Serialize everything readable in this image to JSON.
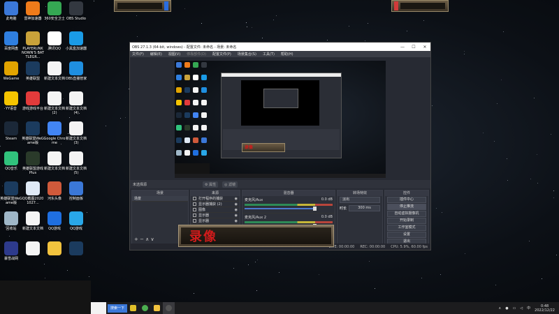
{
  "desktop": {
    "icons": [
      {
        "label": "此电脑",
        "icon": "computer-icon",
        "color": "#3b78d8"
      },
      {
        "label": "雷神加速器",
        "icon": "thunder-accelerator-icon",
        "color": "#ef7b1a"
      },
      {
        "label": "360安全卫士",
        "icon": "360-security-icon",
        "color": "#35a853"
      },
      {
        "label": "OBS Studio",
        "icon": "obs-icon",
        "color": "#333840"
      },
      {
        "label": "百度网盘",
        "icon": "baidu-netdisk-icon",
        "color": "#2f7fe0"
      },
      {
        "label": "PLAYERUNKNOWN'S BATTLEGR...",
        "icon": "pubg-icon",
        "color": "#c9a23a"
      },
      {
        "label": "腾讯QQ",
        "icon": "qq-icon",
        "color": "#ffffff"
      },
      {
        "label": "小黑盒加速器",
        "icon": "xiaoheihe-icon",
        "color": "#1a9be6"
      },
      {
        "label": "WeGame",
        "icon": "wegame-icon",
        "color": "#e2a400"
      },
      {
        "label": "英雄联盟",
        "icon": "lol-icon",
        "color": "#1b3b5e"
      },
      {
        "label": "新建文本文档",
        "icon": "text-file-icon",
        "color": "#f4f4f4"
      },
      {
        "label": "OBS直播管家",
        "icon": "obs-helper-icon",
        "color": "#1f8fe0"
      },
      {
        "label": "YY语音",
        "icon": "yy-icon",
        "color": "#f5c400"
      },
      {
        "label": "游戏游戏平台",
        "icon": "game-platform-icon",
        "color": "#e23b3b"
      },
      {
        "label": "新建文本文档 (2)",
        "icon": "text-file-icon",
        "color": "#f4f4f4"
      },
      {
        "label": "新建文本文档 (4)",
        "icon": "text-file-icon",
        "color": "#f4f4f4"
      },
      {
        "label": "Steam",
        "icon": "steam-icon",
        "color": "#1b2838"
      },
      {
        "label": "英雄联盟WeGame版",
        "icon": "lol-icon",
        "color": "#1b3b5e"
      },
      {
        "label": "Google Chrome",
        "icon": "chrome-icon",
        "color": "#4285f4"
      },
      {
        "label": "新建文本文档 (3)",
        "icon": "text-file-icon",
        "color": "#f4f4f4"
      },
      {
        "label": "QQ音乐",
        "icon": "qq-music-icon",
        "color": "#31c27c"
      },
      {
        "label": "英雄联盟游戏 Plus",
        "icon": "lol-plus-icon",
        "color": "#2a3a2a"
      },
      {
        "label": "新建文本文档",
        "icon": "text-file-icon",
        "color": "#f4f4f4"
      },
      {
        "label": "新建文本文档 (5)",
        "icon": "text-file-icon",
        "color": "#f4f4f4"
      },
      {
        "label": "英雄联盟WeGame版",
        "icon": "lol-icon",
        "color": "#1b3b5e"
      },
      {
        "label": "QQ截图20201027...",
        "icon": "screenshot-icon",
        "color": "#dfe9f5"
      },
      {
        "label": "河东头像",
        "icon": "avatar-image-icon",
        "color": "#d05a3b"
      },
      {
        "label": "控制面板",
        "icon": "control-panel-icon",
        "color": "#3b78d8"
      },
      {
        "label": "回收站",
        "icon": "recycle-bin-icon",
        "color": "#9fb7c8"
      },
      {
        "label": "新建文本文档",
        "icon": "text-file-icon",
        "color": "#f4f4f4"
      },
      {
        "label": "QQ游戏",
        "icon": "qq-game-icon",
        "color": "#1f6fe0"
      },
      {
        "label": "QQ游戏",
        "icon": "qq-game-icon",
        "color": "#29a7e8"
      },
      {
        "label": "暴雪战网",
        "icon": "battlenet-icon",
        "color": "#2d3a8c"
      },
      {
        "label": "",
        "icon": "text-file-icon",
        "color": "#f4f4f4"
      },
      {
        "label": "",
        "icon": "folder-icon",
        "color": "#f2c33e"
      },
      {
        "label": "",
        "icon": "lol-icon",
        "color": "#1b3b5e"
      }
    ]
  },
  "obs": {
    "title": "OBS 27.1.3 (64-bit, windows) - 配置文件: 未命名 - 场景: 未命名",
    "menu": [
      "文件(F)",
      "编辑(E)",
      "视图(V)",
      "停靠部件(D)",
      "配置文件(P)",
      "场景集合(S)",
      "工具(T)",
      "帮助(H)"
    ],
    "status_label": "未选择源",
    "properties_btn": "属性",
    "filters_btn": "滤镜",
    "docks": {
      "scenes": {
        "title": "场景",
        "items": [
          "场景"
        ]
      },
      "sources": {
        "title": "来源",
        "items": [
          "打开程序的捕获",
          "显示器捕获 (2)",
          "图像",
          "显示器",
          "显示器"
        ]
      },
      "mixer": {
        "title": "混音器",
        "channels": [
          {
            "name": "麦克风/Aux",
            "db": "0.0 dB"
          },
          {
            "name": "麦克风/Aux 2",
            "db": "0.0 dB"
          }
        ]
      },
      "transitions": {
        "title": "转场特效",
        "type": "淡出",
        "duration_label": "时长",
        "duration_value": "300 ms"
      },
      "controls": {
        "title": "控件",
        "buttons": [
          "插件中心",
          "停止推流",
          "自动虚拟摄像机",
          "开始录制",
          "工作室模式",
          "设置",
          "退出"
        ]
      }
    },
    "statusbar": {
      "live": "LIVE: 00:00:00",
      "rec": "REC: 00:00:00",
      "cpu": "CPU: 5.9%, 60.00 fps"
    }
  },
  "overlay": {
    "recording_text": "录像"
  },
  "taskbar": {
    "task_label": "搜索一下",
    "time": "0:48",
    "date": "2022/12/22",
    "language": "中"
  }
}
